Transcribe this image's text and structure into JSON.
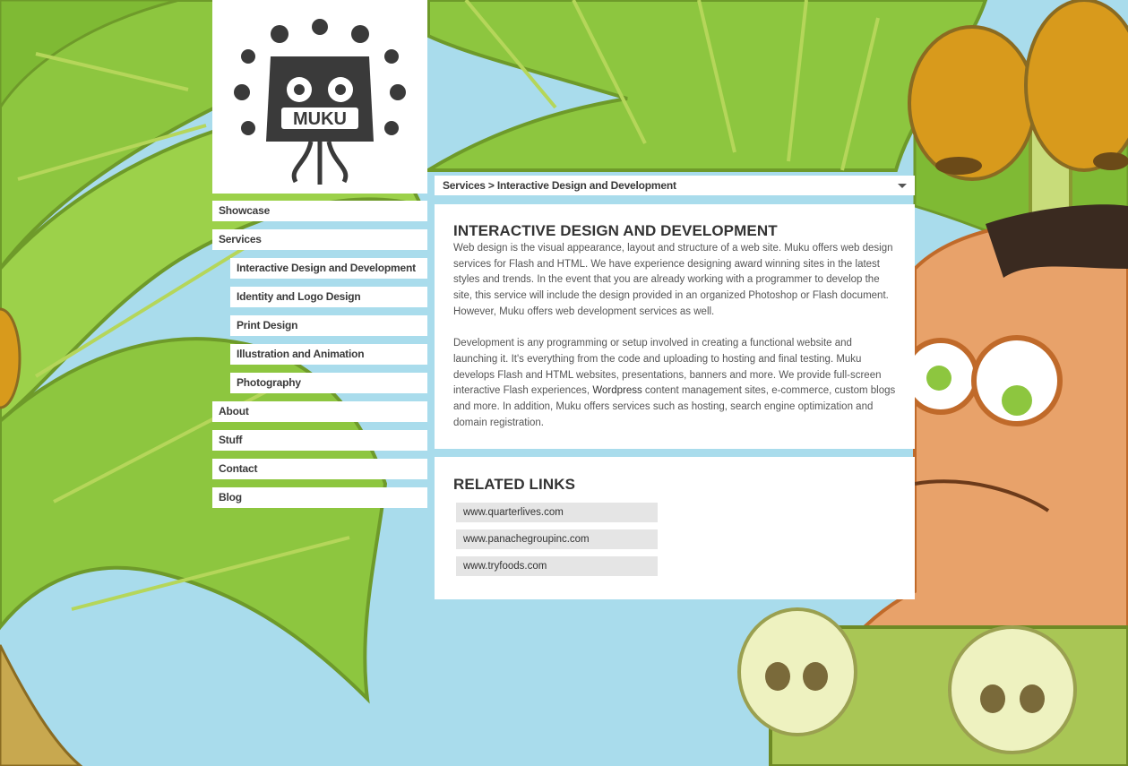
{
  "logo": {
    "text": "MUKU"
  },
  "breadcrumb": {
    "text": "Services > Interactive Design and Development"
  },
  "nav": {
    "items": [
      {
        "label": "Showcase"
      },
      {
        "label": "Services"
      },
      {
        "label": "Interactive Design and Development"
      },
      {
        "label": "Identity and Logo Design"
      },
      {
        "label": "Print Design"
      },
      {
        "label": "Illustration and Animation"
      },
      {
        "label": "Photography"
      },
      {
        "label": "About"
      },
      {
        "label": "Stuff"
      },
      {
        "label": "Contact"
      },
      {
        "label": "Blog"
      }
    ]
  },
  "main": {
    "title": "INTERACTIVE DESIGN AND DEVELOPMENT",
    "para1": "Web design is the visual appearance, layout and structure of a web site. Muku offers web design services for Flash and HTML. We have experience designing award winning sites in the latest styles and trends. In the event that you are already working with a programmer to develop the site, this service will include the design provided in an organized Photoshop or Flash document. However, Muku offers web development services as well.",
    "para2_before": "Development is any programming or setup involved in creating a functional website and launching it. It's everything from the code and uploading to hosting and final testing. Muku develops Flash and HTML websites, presentations, banners and more. We provide full-screen interactive Flash experiences, ",
    "para2_link": "Wordpress",
    "para2_after": " content management sites, e-commerce, custom blogs and more. In addition, Muku offers services such as hosting, search engine optimization and domain registration."
  },
  "related": {
    "title": "RELATED LINKS",
    "links": [
      {
        "label": "www.quarterlives.com"
      },
      {
        "label": "www.panachegroupinc.com"
      },
      {
        "label": "www.tryfoods.com"
      }
    ]
  },
  "colors": {
    "sky": "#a9dcec",
    "leaf": "#8dc63f",
    "leaf_dark": "#5f9a1f",
    "trunk": "#c8a84f",
    "coconut": "#d89a1c",
    "skin": "#e8a26a",
    "hair": "#3a2a20"
  }
}
